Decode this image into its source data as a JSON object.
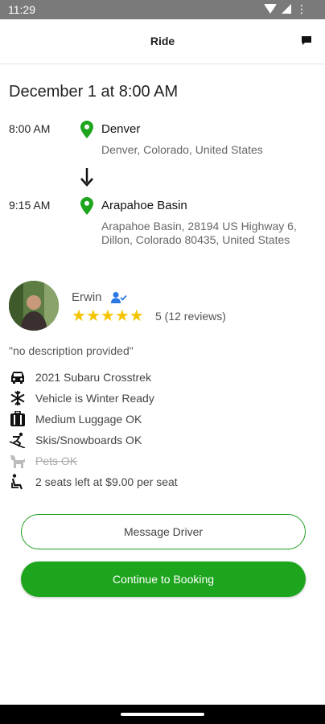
{
  "status_bar": {
    "time": "11:29"
  },
  "app_bar": {
    "title": "Ride"
  },
  "ride": {
    "date": "December 1 at 8:00 AM",
    "origin": {
      "time": "8:00 AM",
      "name": "Denver",
      "address": "Denver, Colorado, United States"
    },
    "destination": {
      "time": "9:15 AM",
      "name": "Arapahoe Basin",
      "address": "Arapahoe Basin, 28194 US Highway 6, Dillon, Colorado 80435, United States"
    }
  },
  "driver": {
    "name": "Erwin",
    "stars": 5,
    "rating_text": "5 (12 reviews)",
    "description": "\"no description provided\""
  },
  "features": [
    {
      "icon": "car-icon",
      "label": "2021 Subaru Crosstrek",
      "available": true
    },
    {
      "icon": "snowflake-icon",
      "label": "Vehicle is Winter Ready",
      "available": true
    },
    {
      "icon": "luggage-icon",
      "label": "Medium Luggage OK",
      "available": true
    },
    {
      "icon": "skier-icon",
      "label": "Skis/Snowboards OK",
      "available": true
    },
    {
      "icon": "dog-icon",
      "label": "Pets OK",
      "available": false
    },
    {
      "icon": "seat-icon",
      "label": "2 seats left at $9.00 per seat",
      "available": true
    }
  ],
  "actions": {
    "message_label": "Message Driver",
    "continue_label": "Continue to Booking"
  },
  "colors": {
    "accent": "#1ea51e",
    "star": "#f5c400",
    "verified": "#2b78e4",
    "pin": "#1ea51e"
  }
}
